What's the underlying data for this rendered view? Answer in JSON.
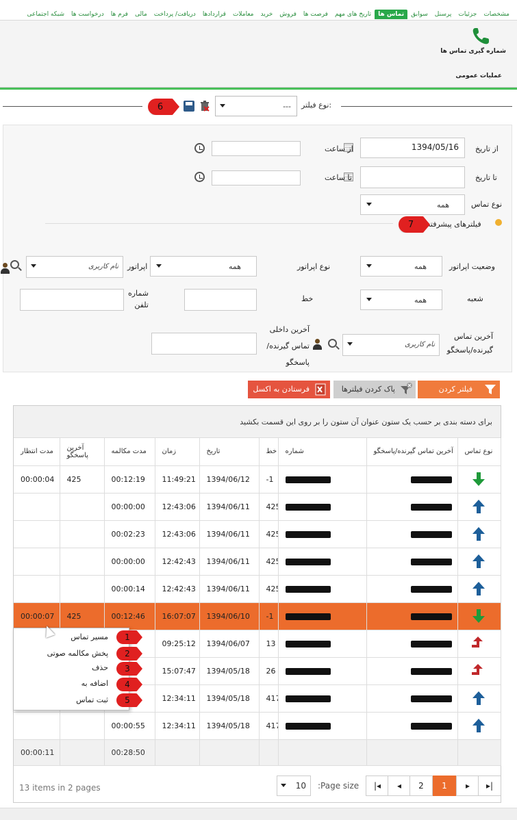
{
  "tabs": [
    "مشخصات",
    "جزئیات",
    "پرسنل",
    "سوابق",
    "تماس ها",
    "تاریخ های مهم",
    "فرصت ها",
    "فروش",
    "خرید",
    "معاملات",
    "قراردادها",
    "دریافت/ پرداخت",
    "مالی",
    "فرم ها",
    "درخواست ها",
    "شبکه اجتماعی"
  ],
  "active_tab": "تماس ها",
  "ribbon": {
    "phone_label": "شماره گیری تماس ها",
    "group_label": "عملیات عمومی",
    "icon": "phone-icon"
  },
  "filter_type": {
    "label": "نوع فیلتر:",
    "value": "---",
    "marker": "6"
  },
  "form": {
    "from_date_label": "از تاریخ",
    "from_date_value": "1394/05/16",
    "from_time_label": "از ساعت",
    "from_time_value": "",
    "to_date_label": "تا تاریخ",
    "to_date_value": "",
    "to_time_label": "تا ساعت",
    "to_time_value": "",
    "call_type_label": "نوع تماس",
    "call_type_value": "همه",
    "advanced_label": "فیلترهای پیشرفته",
    "advanced_marker": "7",
    "operator_status_label": "وضعیت اپراتور",
    "operator_status_value": "همه",
    "operator_type_label": "نوع اپراتور",
    "operator_type_value": "همه",
    "operator_label": "اپراتور",
    "operator_value": "نام کاربری",
    "branch_label": "شعبه",
    "branch_value": "همه",
    "line_label": "خط",
    "line_value": "",
    "phone_label": "شماره تلفن",
    "phone_value": "",
    "last_contact_label": "آخرین تماس گیرنده/پاسخگو",
    "last_contact_value": "نام کاربری",
    "last_internal_label": "آخرین داخلی تماس گیرنده/پاسخگو",
    "last_internal_value": ""
  },
  "buttons": {
    "filter": "فیلتر کردن",
    "clear": "پاک کردن فیلترها",
    "excel": "فرستادن به اکسل"
  },
  "grid": {
    "group_hint": "برای دسته بندی بر حسب یک ستون عنوان آن ستون را بر روی این قسمت بکشید",
    "headers": [
      "نوع تماس",
      "آخرین تماس گیرنده/پاسخگو",
      "شماره",
      "خط",
      "تاریخ",
      "زمان",
      "مدت مکالمه",
      "آخرین پاسخگو",
      "مدت انتظار"
    ],
    "rows": [
      {
        "type": "in",
        "line": "-1",
        "date": "1394/06/12",
        "time": "11:49:21",
        "duration": "00:12:19",
        "responder": "425",
        "wait": "00:00:04"
      },
      {
        "type": "out",
        "line": "425",
        "date": "1394/06/11",
        "time": "12:43:06",
        "duration": "00:00:00",
        "responder": "",
        "wait": ""
      },
      {
        "type": "out",
        "line": "425",
        "date": "1394/06/11",
        "time": "12:43:06",
        "duration": "00:02:23",
        "responder": "",
        "wait": ""
      },
      {
        "type": "out",
        "line": "425",
        "date": "1394/06/11",
        "time": "12:42:43",
        "duration": "00:00:00",
        "responder": "",
        "wait": ""
      },
      {
        "type": "out",
        "line": "425",
        "date": "1394/06/11",
        "time": "12:42:43",
        "duration": "00:00:14",
        "responder": "",
        "wait": ""
      },
      {
        "type": "in",
        "line": "-1",
        "date": "1394/06/10",
        "time": "16:07:07",
        "duration": "00:12:46",
        "responder": "425",
        "wait": "00:00:07",
        "selected": true
      },
      {
        "type": "missed",
        "line": "13",
        "date": "1394/06/07",
        "time": "09:25:12",
        "duration": "",
        "responder": "",
        "wait": ""
      },
      {
        "type": "missed",
        "line": "26",
        "date": "1394/05/18",
        "time": "15:07:47",
        "duration": "",
        "responder": "",
        "wait": ""
      },
      {
        "type": "out",
        "line": "417",
        "date": "1394/05/18",
        "time": "12:34:11",
        "duration": ":00",
        "responder": "",
        "wait": ""
      },
      {
        "type": "out",
        "line": "417",
        "date": "1394/05/18",
        "time": "12:34:11",
        "duration": "00:00:55",
        "responder": "",
        "wait": ""
      }
    ],
    "footer": {
      "duration_total": "00:28:50",
      "wait_total": "00:00:11"
    }
  },
  "pager": {
    "pages": [
      "1",
      "2"
    ],
    "active_page": "1",
    "page_size": "10",
    "page_size_label": ":Page size",
    "info": "13 items in 2 pages"
  },
  "context_menu": [
    {
      "label": "مسیر تماس",
      "marker": "1"
    },
    {
      "label": "پخش مکالمه صوتی",
      "marker": "2"
    },
    {
      "label": "حذف",
      "marker": "3"
    },
    {
      "label": "اضافه به",
      "marker": "4"
    },
    {
      "label": "ثبت تماس",
      "marker": "5"
    }
  ],
  "colors": {
    "accent_green": "#29a84a",
    "orange": "#ec6c2c",
    "arrow_in": "#1f9a3a",
    "arrow_out": "#1d5f9a",
    "arrow_missed": "#c0282b"
  }
}
